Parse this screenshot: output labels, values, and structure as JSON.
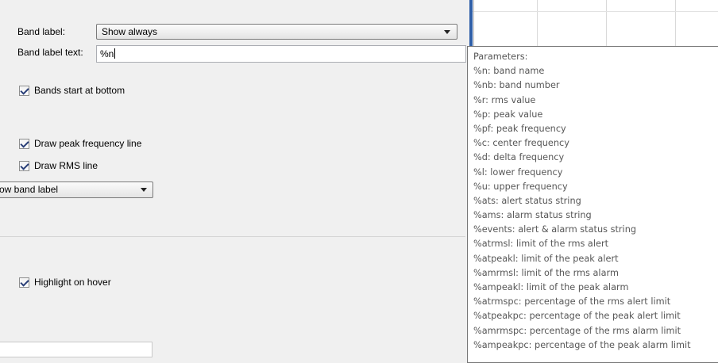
{
  "form": {
    "band_label_caption": "Band label:",
    "band_label_value": "Show always",
    "band_label_text_caption": "Band label text:",
    "band_label_text_value": "%n",
    "checkboxes": {
      "bands_start_at_bottom": {
        "label": "Bands start at bottom",
        "checked": true
      },
      "draw_peak_frequency_line": {
        "label": "Draw peak frequency line",
        "checked": true
      },
      "draw_rms_line": {
        "label": "Draw RMS line",
        "checked": true
      },
      "highlight_on_hover": {
        "label": "Highlight on hover",
        "checked": true
      }
    },
    "partial_dropdown_value": "ow band label"
  },
  "tooltip": {
    "lines": [
      "Parameters:",
      "%n: band name",
      "%nb: band number",
      "%r: rms value",
      "%p: peak value",
      "%pf: peak frequency",
      "%c: center frequency",
      "%d: delta frequency",
      "%l: lower frequency",
      "%u: upper frequency",
      "%ats: alert status string",
      "%ams: alarm status string",
      "%events: alert & alarm status string",
      "%atrmsl: limit of the rms alert",
      "%atpeakl: limit of the peak alert",
      "%amrmsl: limit of the rms alarm",
      "%ampeakl: limit of the peak alarm",
      "%atrmspc: percentage of the rms alert limit",
      "%atpeakpc: percentage of the peak alert limit",
      "%amrmspc: percentage of the rms alarm limit",
      "%ampeakpc: percentage of the peak alarm limit"
    ]
  },
  "icons": {
    "dropdown": "chevron-down-icon",
    "checkbox": "checkmark-icon"
  },
  "colors": {
    "panel_bg": "#f0f0f0",
    "splitter": "#2f5fa8",
    "tooltip_text": "#575757",
    "check_mark": "#2a3f78"
  }
}
